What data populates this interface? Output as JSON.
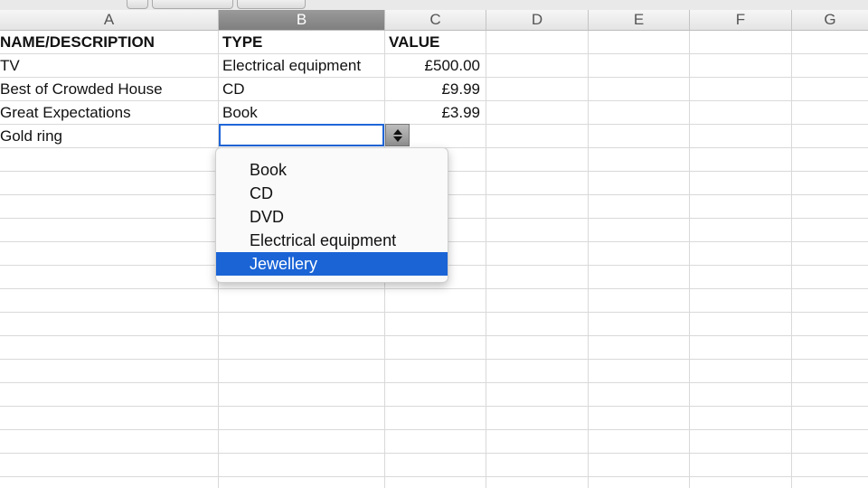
{
  "columns": [
    "A",
    "B",
    "C",
    "D",
    "E",
    "F",
    "G"
  ],
  "selected_column": "B",
  "rows": [
    {
      "a": "NAME/DESCRIPTION",
      "b": "TYPE",
      "c": "VALUE"
    },
    {
      "a": "TV",
      "b": "Electrical equipment",
      "c": "£500.00"
    },
    {
      "a": "Best of Crowded House",
      "b": "CD",
      "c": "£9.99"
    },
    {
      "a": "Great Expectations",
      "b": "Book",
      "c": "£3.99"
    },
    {
      "a": "Gold ring",
      "b": "",
      "c": ""
    }
  ],
  "dropdown": {
    "options": [
      "Book",
      "CD",
      "DVD",
      "Electrical equipment",
      "Jewellery"
    ],
    "highlighted": "Jewellery"
  },
  "colors": {
    "selection_blue": "#1a64d6",
    "active_cell_border": "#1f66d8",
    "selected_header": "#8a8a8a"
  },
  "icons": {
    "dropdown_arrow": "up-down-arrows-icon"
  }
}
